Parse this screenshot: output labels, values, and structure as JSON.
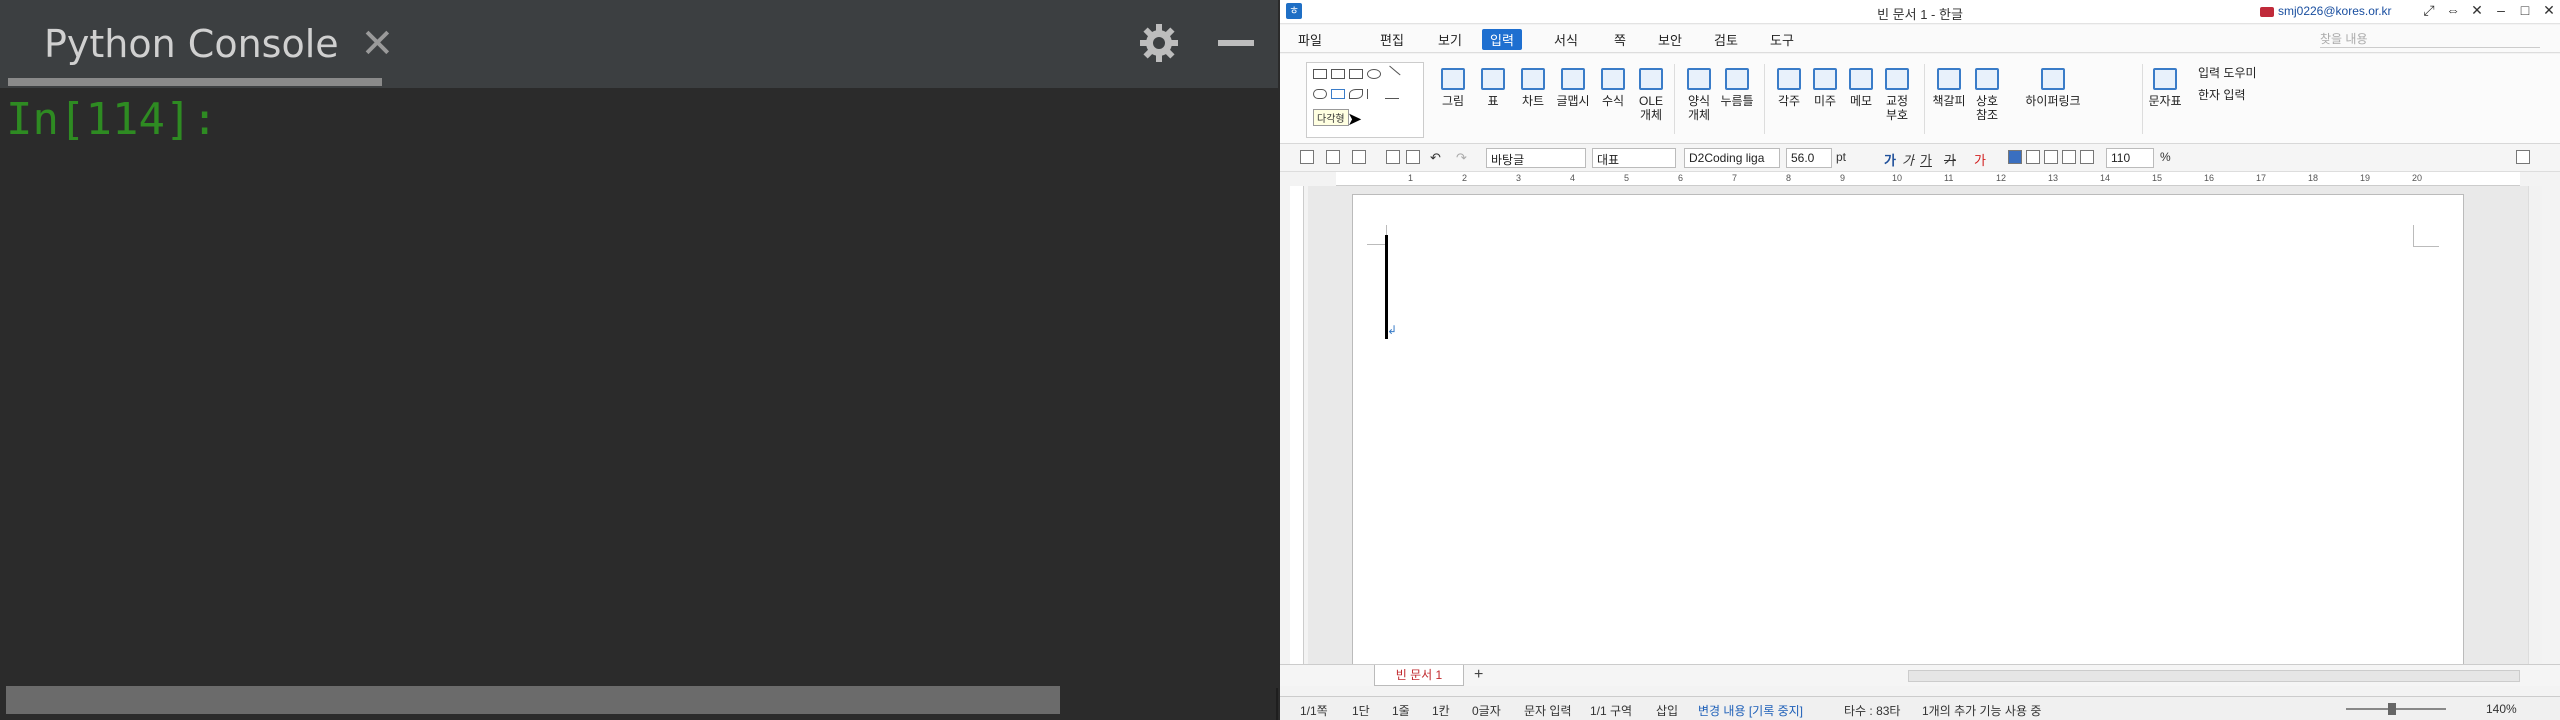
{
  "console": {
    "title": "Python Console",
    "close_glyph": "✕",
    "prompt": "In[114]:"
  },
  "hwp": {
    "window_title": "빈 문서 1 - 한글",
    "account": "smj0226@kores.or.kr",
    "menu": [
      "파일",
      "편집",
      "보기",
      "입력",
      "서식",
      "쪽",
      "보안",
      "검토",
      "도구"
    ],
    "active_menu": "입력",
    "search_placeholder": "찾을 내용",
    "tooltip": "다각형",
    "ribbon_buttons": [
      "그림",
      "표",
      "차트",
      "글맵시",
      "수식",
      "OLE\n개체",
      "양식\n개체",
      "누름틀",
      "각주",
      "미주",
      "메모",
      "교정\n부호",
      "책갈피",
      "상호\n참조",
      "하이퍼링크",
      "문자표"
    ],
    "ribbon_small": [
      "입력 도우미",
      "한자 입력"
    ],
    "toolbar": {
      "style": "바탕글",
      "lang": "대표",
      "font": "D2Coding liga",
      "size": "56.0",
      "unit": "pt",
      "zoom": "110",
      "zoom_unit": "%",
      "bold": "가",
      "italic": "가",
      "underline": "가",
      "strike": "가",
      "color": "가"
    },
    "ruler_numbers": [
      "1",
      "2",
      "3",
      "4",
      "5",
      "6",
      "7",
      "8",
      "9",
      "10",
      "11",
      "12",
      "13",
      "14",
      "15",
      "16",
      "17",
      "18",
      "19",
      "20"
    ],
    "doc_tab": "빈 문서 1",
    "add_tab": "+",
    "status": {
      "page": "1/1쪽",
      "column": "1단",
      "line": "1줄",
      "col": "1칸",
      "chars": "0글자",
      "mode": "문자 입력",
      "section": "1/1 구역",
      "insert": "삽입",
      "track": "변경 내용 [기록 중지]",
      "typing": "타수 : 83타",
      "addon": "1개의 추가 기능 사용 중",
      "zoom": "140%"
    }
  }
}
